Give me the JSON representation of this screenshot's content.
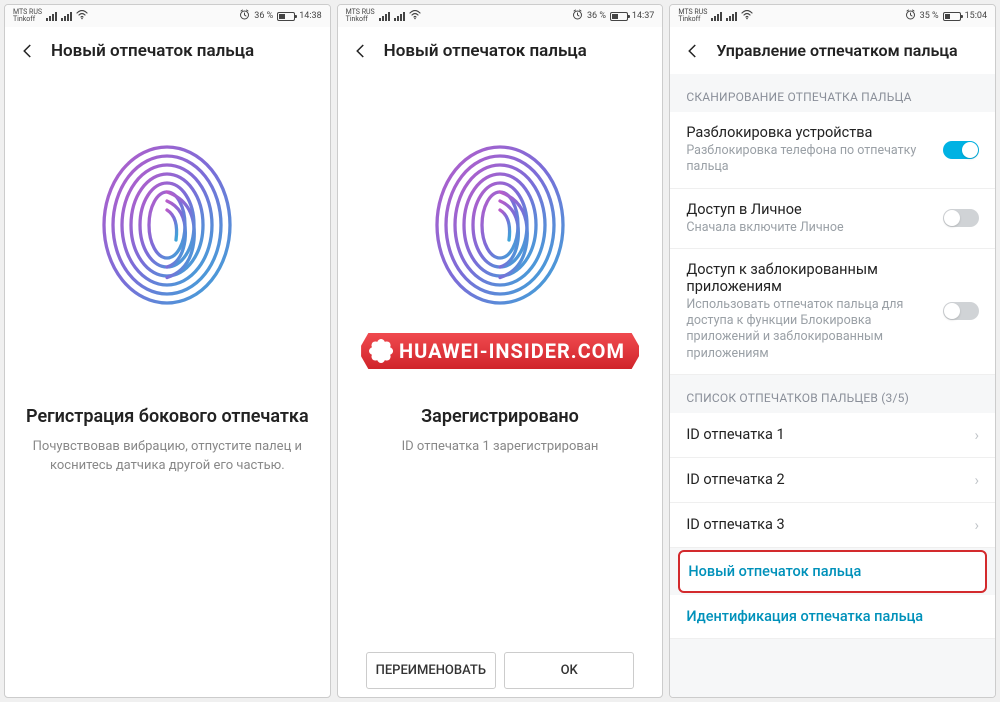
{
  "watermark": "HUAWEI-INSIDER.COM",
  "screen1": {
    "status": {
      "carrier1": "MTS RUS",
      "carrier2": "Tinkoff",
      "battery_text": "36 %",
      "battery_fill": 36,
      "time": "14:38"
    },
    "title": "Новый отпечаток пальца",
    "heading": "Регистрация бокового отпечатка",
    "sub": "Почувствовав вибрацию, отпустите палец и коснитесь датчика другой его частью."
  },
  "screen2": {
    "status": {
      "carrier1": "MTS RUS",
      "carrier2": "Tinkoff",
      "battery_text": "36 %",
      "battery_fill": 36,
      "time": "14:37"
    },
    "title": "Новый отпечаток пальца",
    "heading": "Зарегистрировано",
    "sub": "ID отпечатка 1 зарегистрирован",
    "btn_rename": "ПЕРЕИМЕНОВАТЬ",
    "btn_ok": "OK"
  },
  "screen3": {
    "status": {
      "carrier1": "MTS RUS",
      "carrier2": "Tinkoff",
      "battery_text": "35 %",
      "battery_fill": 35,
      "time": "15:04"
    },
    "title": "Управление отпечатком пальца",
    "section1": "СКАНИРОВАНИЕ ОТПЕЧАТКА ПАЛЬЦА",
    "item_unlock_title": "Разблокировка устройства",
    "item_unlock_sub": "Разблокировка телефона по отпечатку пальца",
    "item_safe_title": "Доступ в Личное",
    "item_safe_sub": "Сначала включите Личное",
    "item_applock_title": "Доступ к заблокированным приложениям",
    "item_applock_sub": "Использовать отпечаток пальца для доступа к функции Блокировка приложений и заблокированным приложениям",
    "section2": "СПИСОК ОТПЕЧАТКОВ ПАЛЬЦЕВ (3/5)",
    "fp1": "ID отпечатка 1",
    "fp2": "ID отпечатка 2",
    "fp3": "ID отпечатка 3",
    "link_new": "Новый отпечаток пальца",
    "link_identify": "Идентификация отпечатка пальца"
  }
}
